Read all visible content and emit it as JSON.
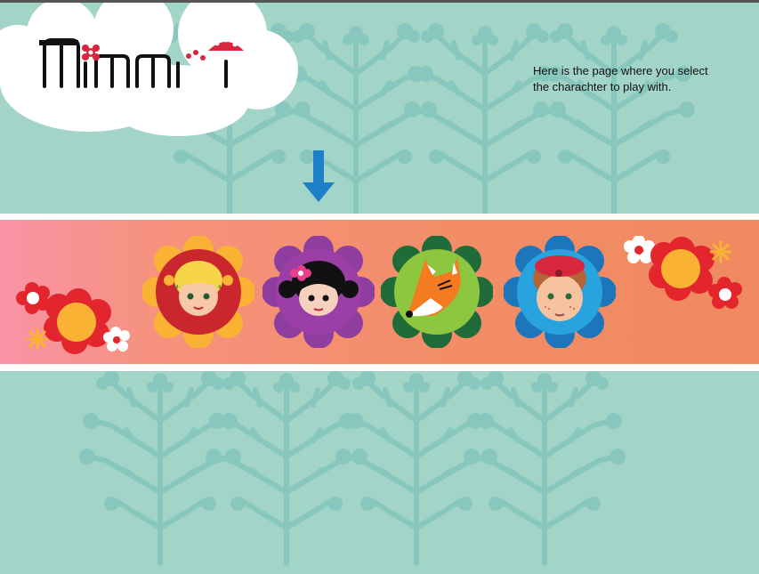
{
  "game": {
    "logo_text": "Mimmit",
    "hint_text": "Here is the page where you select the charachter to play with."
  },
  "characters": [
    {
      "label": "blonde-girl",
      "petal_color": "#f9b233",
      "ring_color": "#c9262d"
    },
    {
      "label": "dark-hair-girl",
      "petal_color": "#8f3ea0",
      "ring_color": "#8a3c9b"
    },
    {
      "label": "fox",
      "petal_color": "#1f6b39",
      "ring_color": "#8dc63f"
    },
    {
      "label": "red-hat-boy",
      "petal_color": "#1d76bb",
      "ring_color": "#29a3df"
    }
  ],
  "colors": {
    "background": "#a3d4c8",
    "tree": "#88c7bd",
    "arrow": "#1e7fc9",
    "band_start": "#f993a6",
    "band_end": "#f0895f"
  }
}
